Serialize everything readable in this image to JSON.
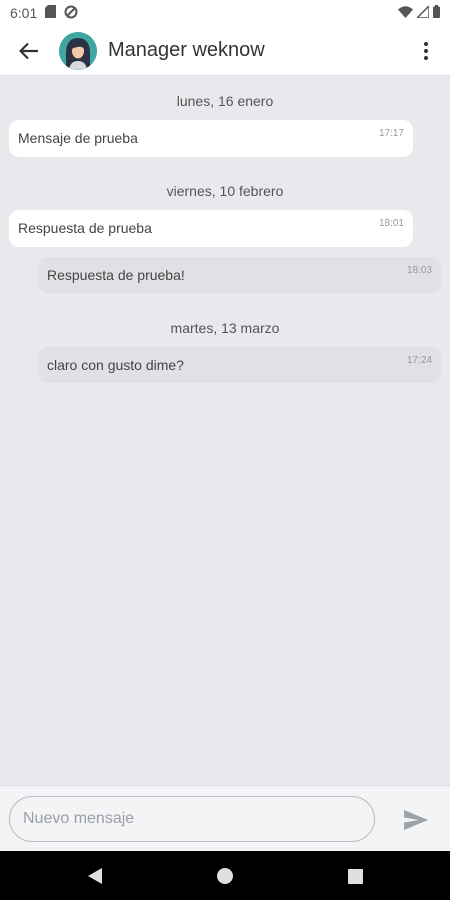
{
  "status_bar": {
    "time": "6:01",
    "icons": [
      "sd-card-icon",
      "sync-icon",
      "wifi-icon",
      "signal-icon",
      "battery-icon"
    ]
  },
  "header": {
    "title": "Manager weknow",
    "avatar_icon": "user-avatar",
    "back_icon": "arrow-left-icon",
    "menu_icon": "more-vert-icon"
  },
  "messages": [
    {
      "type": "date",
      "label": "lunes, 16 enero"
    },
    {
      "type": "incoming",
      "text": "Mensaje de prueba",
      "time": "17:17"
    },
    {
      "type": "date",
      "label": "viernes, 10 febrero"
    },
    {
      "type": "incoming",
      "text": "Respuesta de prueba",
      "time": "18:01"
    },
    {
      "type": "outgoing",
      "text": "Respuesta de prueba!",
      "time": "18:03"
    },
    {
      "type": "date",
      "label": "martes, 13 marzo"
    },
    {
      "type": "outgoing",
      "text": "claro con gusto dime?",
      "time": "17:24"
    }
  ],
  "composer": {
    "placeholder": "Nuevo mensaje",
    "value": "",
    "send_icon": "send-icon"
  },
  "nav_bar": {
    "icons": [
      "nav-back-icon",
      "nav-home-icon",
      "nav-recents-icon"
    ]
  },
  "colors": {
    "chat_bg": "#e7e9ec",
    "incoming_bubble": "#ffffff",
    "outgoing_bubble": "#dfe1e5",
    "header_bg": "#ffffff",
    "nav_bg": "#000000"
  }
}
